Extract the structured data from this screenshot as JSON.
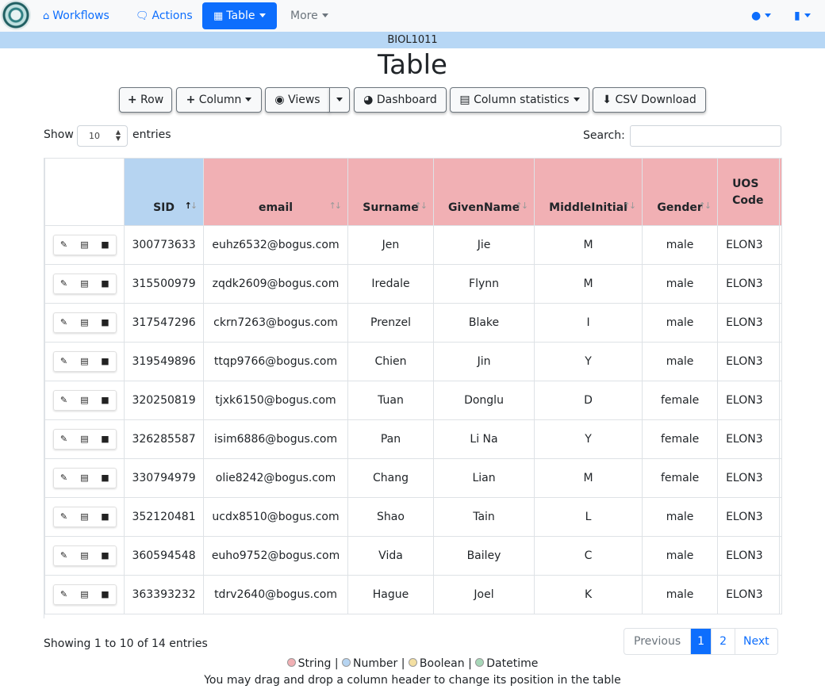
{
  "nav": {
    "workflows": "Workflows",
    "actions": "Actions",
    "table": "Table",
    "more": "More"
  },
  "course": "BIOL1011",
  "page_title": "Table",
  "toolbar": {
    "row": "Row",
    "column": "Column",
    "views": "Views",
    "dashboard": "Dashboard",
    "column_statistics": "Column statistics",
    "csv_download": "CSV Download"
  },
  "length": {
    "show": "Show",
    "value": "10",
    "entries": "entries"
  },
  "search": {
    "label": "Search:",
    "value": ""
  },
  "table": {
    "headers": [
      "SID",
      "email",
      "Surname",
      "GivenName",
      "MiddleInitial",
      "Gender",
      "UOS Code"
    ],
    "rows": [
      [
        "300773633",
        "euhz6532@bogus.com",
        "Jen",
        "Jie",
        "M",
        "male",
        "ELON3"
      ],
      [
        "315500979",
        "zqdk2609@bogus.com",
        "Iredale",
        "Flynn",
        "M",
        "male",
        "ELON3"
      ],
      [
        "317547296",
        "ckrn7263@bogus.com",
        "Prenzel",
        "Blake",
        "I",
        "male",
        "ELON3"
      ],
      [
        "319549896",
        "ttqp9766@bogus.com",
        "Chien",
        "Jin",
        "Y",
        "male",
        "ELON3"
      ],
      [
        "320250819",
        "tjxk6150@bogus.com",
        "Tuan",
        "Donglu",
        "D",
        "female",
        "ELON3"
      ],
      [
        "326285587",
        "isim6886@bogus.com",
        "Pan",
        "Li Na",
        "Y",
        "female",
        "ELON3"
      ],
      [
        "330794979",
        "olie8242@bogus.com",
        "Chang",
        "Lian",
        "M",
        "female",
        "ELON3"
      ],
      [
        "352120481",
        "ucdx8510@bogus.com",
        "Shao",
        "Tain",
        "L",
        "male",
        "ELON3"
      ],
      [
        "360594548",
        "euho9752@bogus.com",
        "Vida",
        "Bailey",
        "C",
        "male",
        "ELON3"
      ],
      [
        "363393232",
        "tdrv2640@bogus.com",
        "Hague",
        "Joel",
        "K",
        "male",
        "ELON3"
      ]
    ]
  },
  "info": "Showing 1 to 10 of 14 entries",
  "pagination": {
    "previous": "Previous",
    "pages": [
      "1",
      "2"
    ],
    "next": "Next"
  },
  "legend": {
    "string": "String",
    "number": "Number",
    "boolean": "Boolean",
    "datetime": "Datetime",
    "sep": "|",
    "colors": {
      "string": "#f1b0b4",
      "number": "#b6d4f1",
      "boolean": "#f3dfa2",
      "datetime": "#a8d8b9"
    }
  },
  "hint": "You may drag and drop a column header to change its position in the table"
}
